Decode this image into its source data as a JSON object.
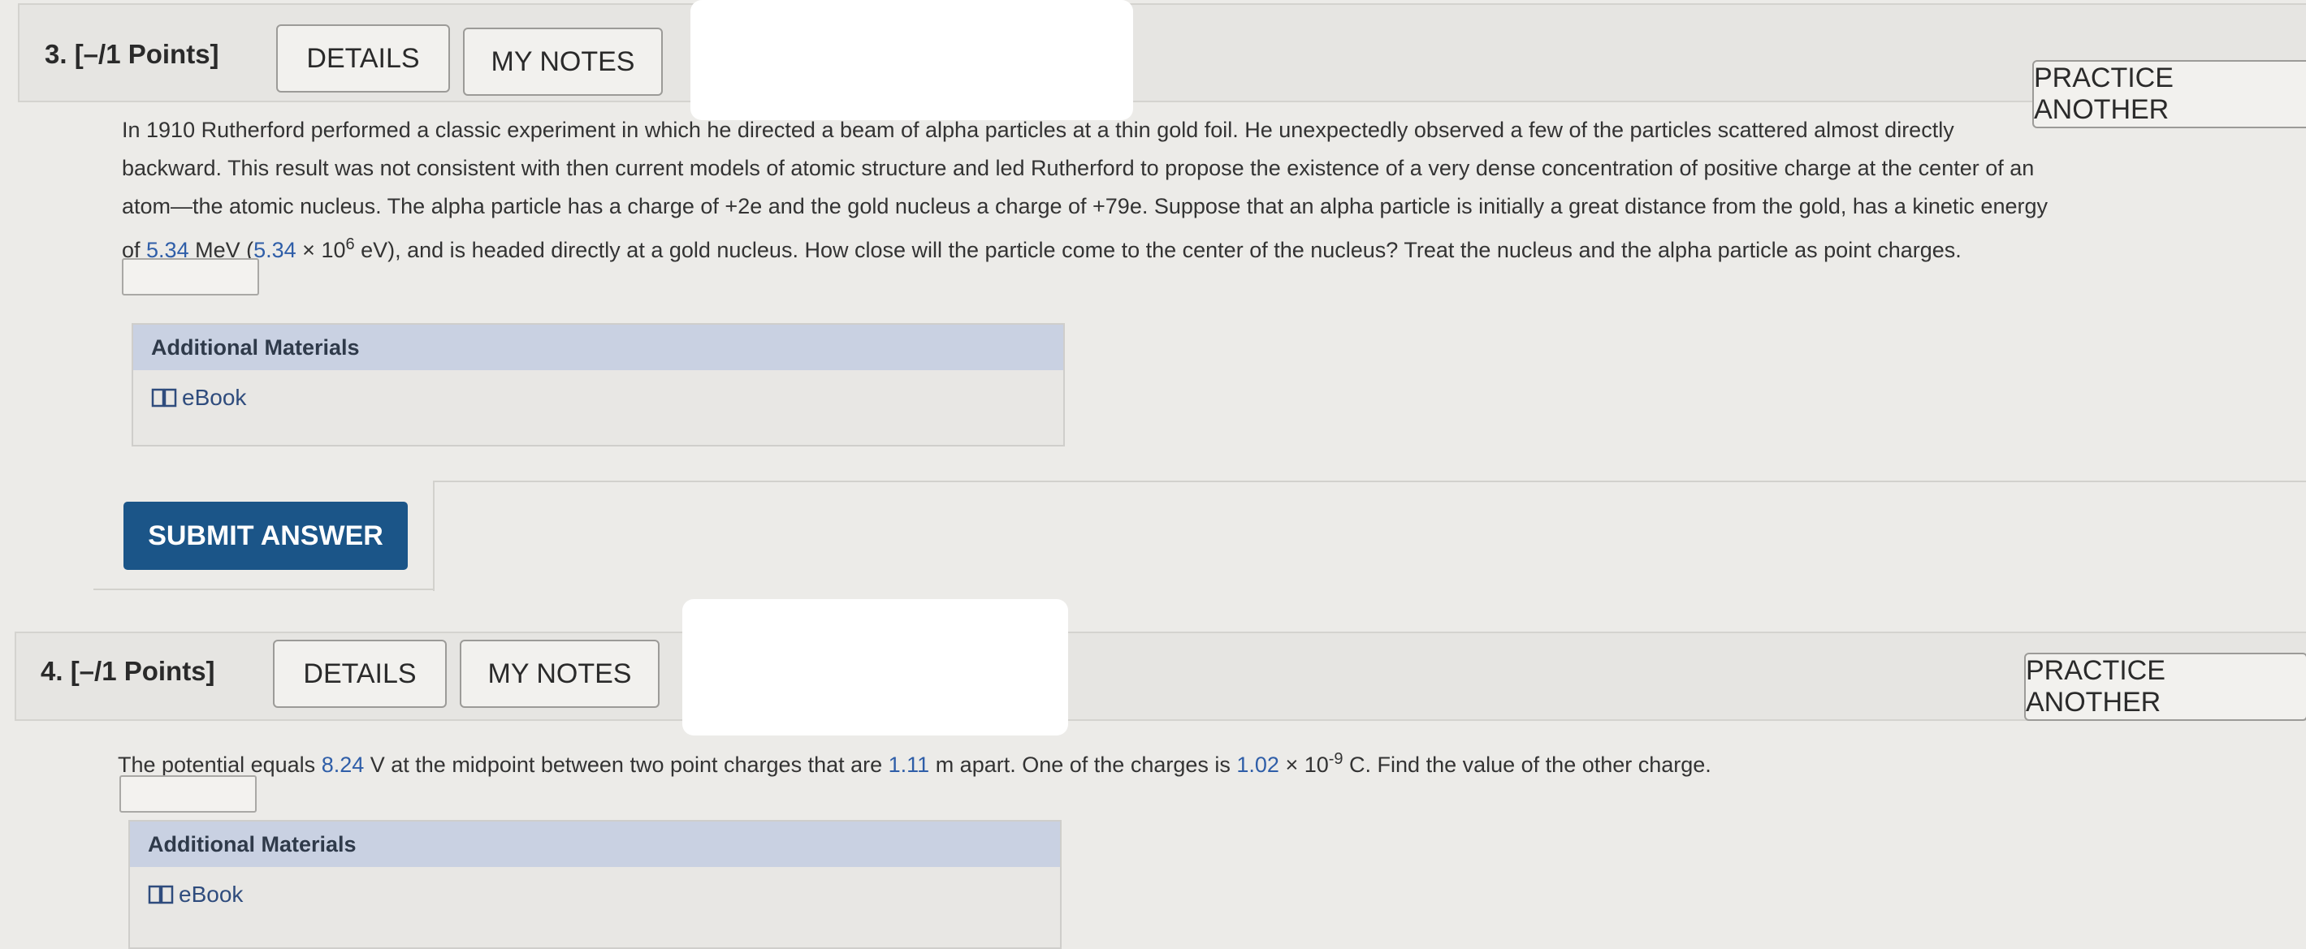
{
  "q3": {
    "label": "3. [–/1 Points]",
    "details": "DETAILS",
    "notes": "MY NOTES",
    "practice": "PRACTICE ANOTHER",
    "line1": "In 1910 Rutherford performed a classic experiment in which he directed a beam of alpha particles at a thin gold foil. He unexpectedly observed a few of the particles scattered almost directly",
    "line2": "backward. This result was not consistent with then current models of atomic structure and led Rutherford to propose the existence of a very dense concentration of positive charge at the center of an",
    "line3": "atom—the atomic nucleus. The alpha particle has a charge of +2e and the gold nucleus a charge of +79e. Suppose that an alpha particle is initially a great distance from the gold, has a kinetic energy",
    "line4_pre": "of ",
    "energy": "5.34",
    "energy_unit": " MeV (",
    "energy_ev": "5.34",
    "times": " × 10",
    "exp": "6",
    "line4_post": " eV), and is headed directly at a gold nucleus. How close will the particle come to the center of the nucleus? Treat the nucleus and the alpha particle as point charges.",
    "materials": "Additional Materials",
    "ebook": "eBook",
    "submit": "SUBMIT ANSWER"
  },
  "q4": {
    "label": "4. [–/1 Points]",
    "details": "DETAILS",
    "notes": "MY NOTES",
    "practice": "PRACTICE ANOTHER",
    "text_a": "The potential equals ",
    "potential": "8.24",
    "text_b": " V at the midpoint between two point charges that are ",
    "distance": "1.11",
    "text_c": " m apart. One of the charges is ",
    "charge": "1.02",
    "times": " × 10",
    "exp": "-9",
    "text_d": " C. Find the value of the other charge.",
    "materials": "Additional Materials",
    "ebook": "eBook"
  },
  "colors": {
    "accent": "#2f5ea8",
    "submit": "#1b5588",
    "materials_header": "#c9d1e2"
  }
}
